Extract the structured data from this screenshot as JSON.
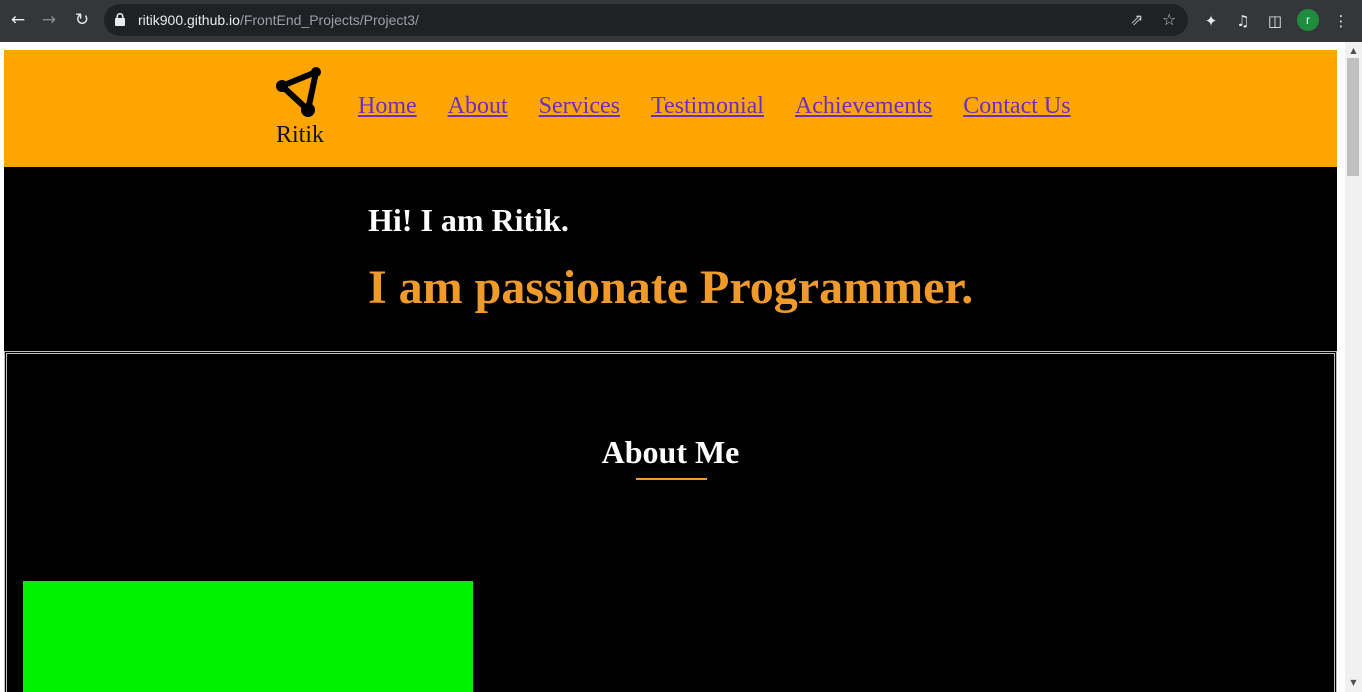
{
  "browser": {
    "url_host": "ritik900.github.io",
    "url_path": "/FrontEnd_Projects/Project3/",
    "profile_initial": "r",
    "icons": [
      "back-icon",
      "forward-icon",
      "reload-icon",
      "lock-icon",
      "share-icon",
      "star-icon",
      "extensions-icon",
      "media-icon",
      "side-panel-icon",
      "menu-icon"
    ]
  },
  "header": {
    "logo_text": "Ritik",
    "nav": [
      "Home",
      "About",
      "Services",
      "Testimonial",
      "Achievements",
      "Contact Us"
    ]
  },
  "hero": {
    "greeting": "Hi! I am Ritik.",
    "tagline": "I am passionate Programmer."
  },
  "about": {
    "title": "About Me"
  },
  "colors": {
    "header_bg": "#ffa500",
    "accent": "#f09a2a",
    "nav_link": "#6a2fbf",
    "image_placeholder": "#00f000"
  }
}
